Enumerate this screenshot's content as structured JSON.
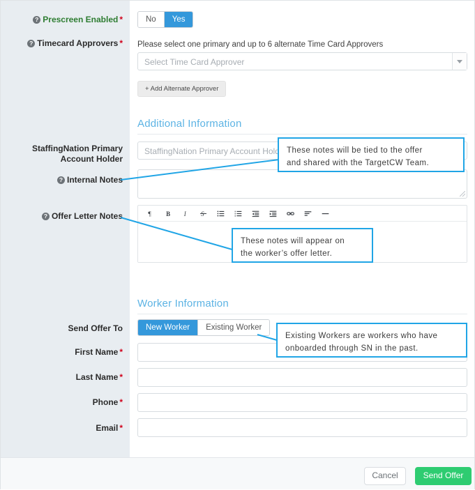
{
  "form": {
    "prescreen": {
      "label": "Prescreen Enabled",
      "required": "*",
      "help_icon": "question-circle-icon",
      "options": [
        "No",
        "Yes"
      ],
      "selected": "Yes"
    },
    "timecard_approvers": {
      "label": "Timecard Approvers",
      "required": "*",
      "help_icon": "question-circle-icon",
      "instruction": "Please select one primary and up to 6 alternate Time Card Approvers",
      "select_placeholder": "Select Time Card Approver",
      "select_value": "",
      "caret_icon": "chevron-down-icon",
      "add_alternate_label": "+ Add Alternate Approver"
    }
  },
  "additional_information": {
    "heading": "Additional Information",
    "primary_account_holder": {
      "label": "StaffingNation Primary Account Holder",
      "placeholder": "StaffingNation Primary Account Holder",
      "value": ""
    },
    "internal_notes": {
      "label": "Internal Notes",
      "help_icon": "question-circle-icon",
      "value": "",
      "resize_handle_icon": "resize-grip-icon"
    },
    "offer_letter_notes": {
      "label": "Offer Letter Notes",
      "help_icon": "question-circle-icon",
      "value": "",
      "toolbar": [
        {
          "name": "paragraph-icon",
          "title": "Paragraph"
        },
        {
          "name": "bold-icon",
          "title": "Bold"
        },
        {
          "name": "italic-icon",
          "title": "Italic"
        },
        {
          "name": "strikethrough-icon",
          "title": "Strikethrough"
        },
        {
          "name": "unordered-list-icon",
          "title": "Bulleted List"
        },
        {
          "name": "ordered-list-icon",
          "title": "Numbered List"
        },
        {
          "name": "outdent-icon",
          "title": "Outdent"
        },
        {
          "name": "indent-icon",
          "title": "Indent"
        },
        {
          "name": "link-icon",
          "title": "Link"
        },
        {
          "name": "align-left-icon",
          "title": "Align"
        },
        {
          "name": "horizontal-rule-icon",
          "title": "Horizontal Rule"
        }
      ]
    }
  },
  "worker_information": {
    "heading": "Worker Information",
    "send_offer_to": {
      "label": "Send Offer To",
      "options": [
        "New Worker",
        "Existing Worker"
      ],
      "selected": "New Worker"
    },
    "fields": [
      {
        "label": "First Name",
        "required": "*",
        "value": "",
        "name": "first-name"
      },
      {
        "label": "Last Name",
        "required": "*",
        "value": "",
        "name": "last-name"
      },
      {
        "label": "Phone",
        "required": "*",
        "value": "",
        "name": "phone"
      },
      {
        "label": "Email",
        "required": "*",
        "value": "",
        "name": "email"
      }
    ]
  },
  "callouts": [
    {
      "id": "internal-notes-callout",
      "line1": "These notes will be tied to the offer",
      "line2": "and shared with the TargetCW Team."
    },
    {
      "id": "offer-letter-notes-callout",
      "line1": "These notes will appear on",
      "line2": "the worker’s offer letter."
    },
    {
      "id": "existing-worker-callout",
      "line1": "Existing Workers are workers who have",
      "line2": "onboarded through SN in the past."
    }
  ],
  "footer": {
    "cancel_label": "Cancel",
    "submit_label": "Send Offer"
  },
  "colors": {
    "accent_blue": "#3498db",
    "callout_blue": "#20a5e6",
    "heading_blue": "#5cb3e4",
    "submit_green": "#2ecc71",
    "required_red": "#d0021b",
    "label_panel": "#e8edf1",
    "green_label": "#2e7d32"
  }
}
